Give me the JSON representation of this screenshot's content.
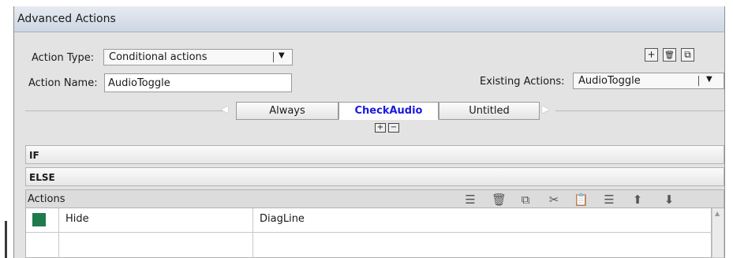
{
  "window": {
    "title": "Advanced Actions"
  },
  "form": {
    "action_type_label": "Action Type:",
    "action_type_value": "Conditional actions",
    "action_name_label": "Action Name:",
    "action_name_value": "AudioToggle",
    "existing_actions_label": "Existing Actions:",
    "existing_actions_value": "AudioToggle"
  },
  "tabs": [
    {
      "label": "Always"
    },
    {
      "label": "CheckAudio",
      "active": true
    },
    {
      "label": "Untitled"
    }
  ],
  "sections": {
    "if_label": "IF",
    "else_label": "ELSE"
  },
  "actions": {
    "title": "Actions",
    "toolbar": [
      "insert-row-icon",
      "delete-icon",
      "copy-icon",
      "cut-icon",
      "paste-icon",
      "insert-after-icon",
      "move-up-icon",
      "move-down-icon"
    ],
    "rows": [
      {
        "color": "#1f7a4c",
        "action": "Hide",
        "target": "DiagLine"
      },
      {
        "color": "",
        "action": "",
        "target": ""
      }
    ]
  },
  "glyphs": {
    "dropdown": "▼",
    "plus": "+",
    "minus": "−",
    "trash": "🗑",
    "duplicate": "⧉"
  }
}
